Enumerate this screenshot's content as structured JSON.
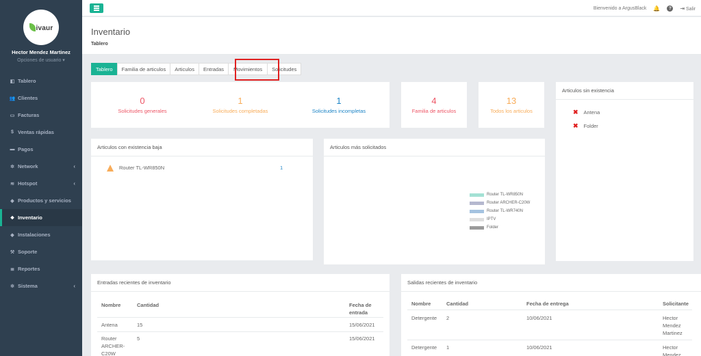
{
  "sidebar": {
    "logo_text": "ivaur",
    "user_name": "Hector Mendez Martinez",
    "user_options": "Opciones de usuario ▾",
    "items": [
      {
        "label": "Tablero",
        "icon": "dashboard-icon",
        "glyph": "◧",
        "chevron": false
      },
      {
        "label": "Clientes",
        "icon": "users-icon",
        "glyph": "👥",
        "chevron": false
      },
      {
        "label": "Facturas",
        "icon": "file-icon",
        "glyph": "▭",
        "chevron": false
      },
      {
        "label": "Ventas rápidas",
        "icon": "dollar-icon",
        "glyph": "$",
        "chevron": false
      },
      {
        "label": "Pagos",
        "icon": "money-icon",
        "glyph": "▬",
        "chevron": false
      },
      {
        "label": "Network",
        "icon": "network-icon",
        "glyph": "✲",
        "chevron": true
      },
      {
        "label": "Hotspot",
        "icon": "wifi-icon",
        "glyph": "≋",
        "chevron": true
      },
      {
        "label": "Productos y servicios",
        "icon": "tag-icon",
        "glyph": "◆",
        "chevron": false
      },
      {
        "label": "Inventario",
        "icon": "cubes-icon",
        "glyph": "❖",
        "chevron": false,
        "active": true
      },
      {
        "label": "Instalaciones",
        "icon": "wrench-tag-icon",
        "glyph": "◆",
        "chevron": false
      },
      {
        "label": "Soporte",
        "icon": "wrench-icon",
        "glyph": "⚒",
        "chevron": false
      },
      {
        "label": "Reportes",
        "icon": "database-icon",
        "glyph": "≣",
        "chevron": false
      },
      {
        "label": "Sistema",
        "icon": "gears-icon",
        "glyph": "✲",
        "chevron": true
      }
    ]
  },
  "topbar": {
    "welcome": "Bienvenido a ArgusBlack",
    "logout": "Salir"
  },
  "header": {
    "title": "Inventario",
    "breadcrumb": "Tablero"
  },
  "tabs": [
    "Tablero",
    "Familia de articulos",
    "Articulos",
    "Entradas",
    "Movimientos",
    "Solicitudes"
  ],
  "stats": {
    "s1": {
      "value": "0",
      "label": "Solicitudes generales"
    },
    "s2": {
      "value": "1",
      "label": "Solicitudes completadas"
    },
    "s3": {
      "value": "1",
      "label": "Solicitudes incompletas"
    },
    "s4": {
      "value": "4",
      "label": "Familia de articulos"
    },
    "s5": {
      "value": "13",
      "label": "Todos los articulos"
    }
  },
  "sin_existencia": {
    "title": "Articulos sin existencia",
    "items": [
      "Antena",
      "Folder"
    ]
  },
  "existencia_baja": {
    "title": "Articulos con existencia baja",
    "item": "Router TL-WR850N",
    "qty": "1"
  },
  "mas_solicitados": {
    "title": "Articulos más solicitados",
    "legend": [
      {
        "label": "Router TL-WR850N",
        "color": "#a3e1d4"
      },
      {
        "label": "Router ARCHER-C20W",
        "color": "#b5b8cf"
      },
      {
        "label": "Router TL-WR740N",
        "color": "#a5c3e0"
      },
      {
        "label": "IPTV",
        "color": "#dedede"
      },
      {
        "label": "Folder",
        "color": "#9a9a9a"
      }
    ]
  },
  "entradas": {
    "title": "Entradas recientes de inventario",
    "headers": [
      "Nombre",
      "Cantidad",
      "Fecha de entrada"
    ],
    "rows": [
      {
        "nombre": "Antena",
        "cantidad": "15",
        "fecha": "15/06/2021"
      },
      {
        "nombre": "Router ARCHER-C20W",
        "cantidad": "5",
        "fecha": "15/06/2021"
      }
    ]
  },
  "salidas": {
    "title": "Salidas recientes de inventario",
    "headers": [
      "Nombre",
      "Cantidad",
      "Fecha de entrega",
      "Solicitante"
    ],
    "rows": [
      {
        "nombre": "Detergente",
        "cantidad": "2",
        "fecha": "10/06/2021",
        "solicitante": "Hector Mendez Martinez"
      },
      {
        "nombre": "Detergente",
        "cantidad": "1",
        "fecha": "10/06/2021",
        "solicitante": "Hector Mendez"
      }
    ]
  }
}
